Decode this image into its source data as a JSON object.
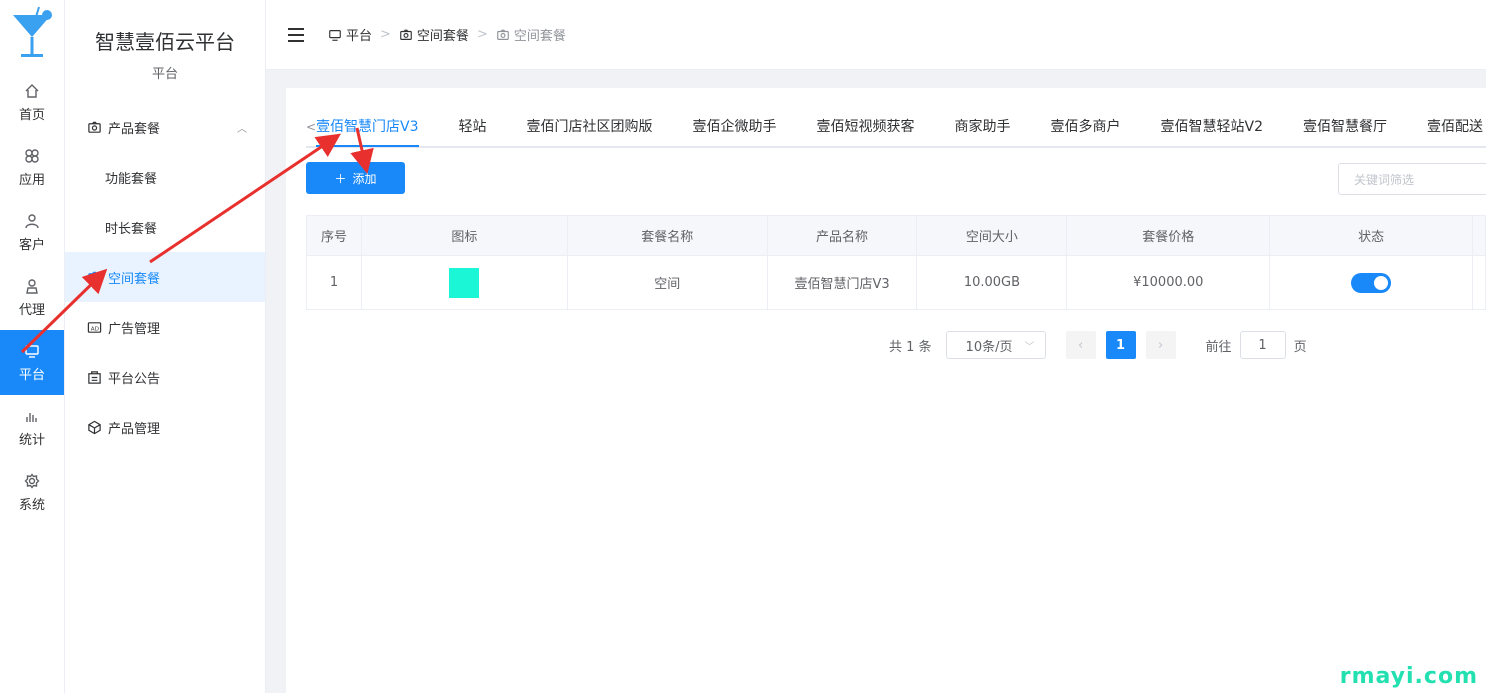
{
  "rail": {
    "items": [
      {
        "label": "首页",
        "icon": "home-icon"
      },
      {
        "label": "应用",
        "icon": "apps-icon"
      },
      {
        "label": "客户",
        "icon": "user-icon"
      },
      {
        "label": "代理",
        "icon": "agent-icon"
      },
      {
        "label": "平台",
        "icon": "monitor-icon",
        "active": true
      },
      {
        "label": "统计",
        "icon": "stats-icon"
      },
      {
        "label": "系统",
        "icon": "gear-icon"
      }
    ]
  },
  "sidebar": {
    "title": "智慧壹佰云平台",
    "subtitle": "平台",
    "group_label": "产品套餐",
    "sub_items": [
      "功能套餐",
      "时长套餐"
    ],
    "items": [
      "空间套餐",
      "广告管理",
      "平台公告",
      "产品管理"
    ]
  },
  "header": {
    "breadcrumbs": [
      "平台",
      "空间套餐",
      "空间套餐"
    ]
  },
  "tabs": [
    "壹佰智慧门店V3",
    "轻站",
    "壹佰门店社区团购版",
    "壹佰企微助手",
    "壹佰短视频获客",
    "商家助手",
    "壹佰多商户",
    "壹佰智慧轻站V2",
    "壹佰智慧餐厅",
    "壹佰配送"
  ],
  "toolbar": {
    "add_label": "添加",
    "search_placeholder": "关键词筛选"
  },
  "table": {
    "columns": [
      "序号",
      "图标",
      "套餐名称",
      "产品名称",
      "空间大小",
      "套餐价格",
      "状态"
    ],
    "rows": [
      {
        "index": "1",
        "name": "空间",
        "product": "壹佰智慧门店V3",
        "size": "10.00GB",
        "price": "¥10000.00",
        "status_on": true,
        "icon_color": "#1bf7d6"
      }
    ]
  },
  "pager": {
    "total": "共 1 条",
    "page_size": "10条/页",
    "current": "1",
    "goto_prefix": "前往",
    "goto_value": "1",
    "goto_suffix": "页"
  },
  "watermark": "rmayi.com",
  "colors": {
    "accent": "#1989fa",
    "arrow": "#e8312f"
  }
}
